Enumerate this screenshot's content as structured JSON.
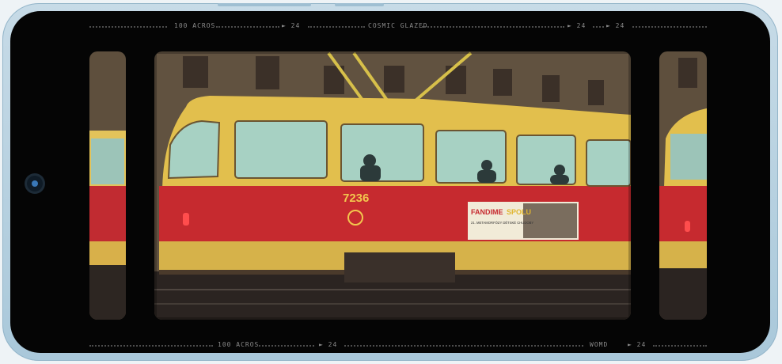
{
  "top_strip": {
    "frame_id": "100 ACROS",
    "counter_1": "24",
    "film_name": "COSMIC GLAZED",
    "counter_2": "24",
    "counter_3": "24"
  },
  "bottom_strip": {
    "frame_id": "100 ACROS",
    "counter_1": "24",
    "mode": "WOMD",
    "counter_2": "24"
  },
  "photo": {
    "tram_number": "7236",
    "ad_title": "FANDIME",
    "ad_title_accent": "SPOLU",
    "ad_subtitle": "21. METAMORFÓZY DĚTSKÉ CHUDOBY"
  },
  "colors": {
    "tram_red": "#c62a2f",
    "tram_yellow": "#e6c14a",
    "building": "#6b5a45",
    "phone_frame": "#b5d0e0"
  }
}
